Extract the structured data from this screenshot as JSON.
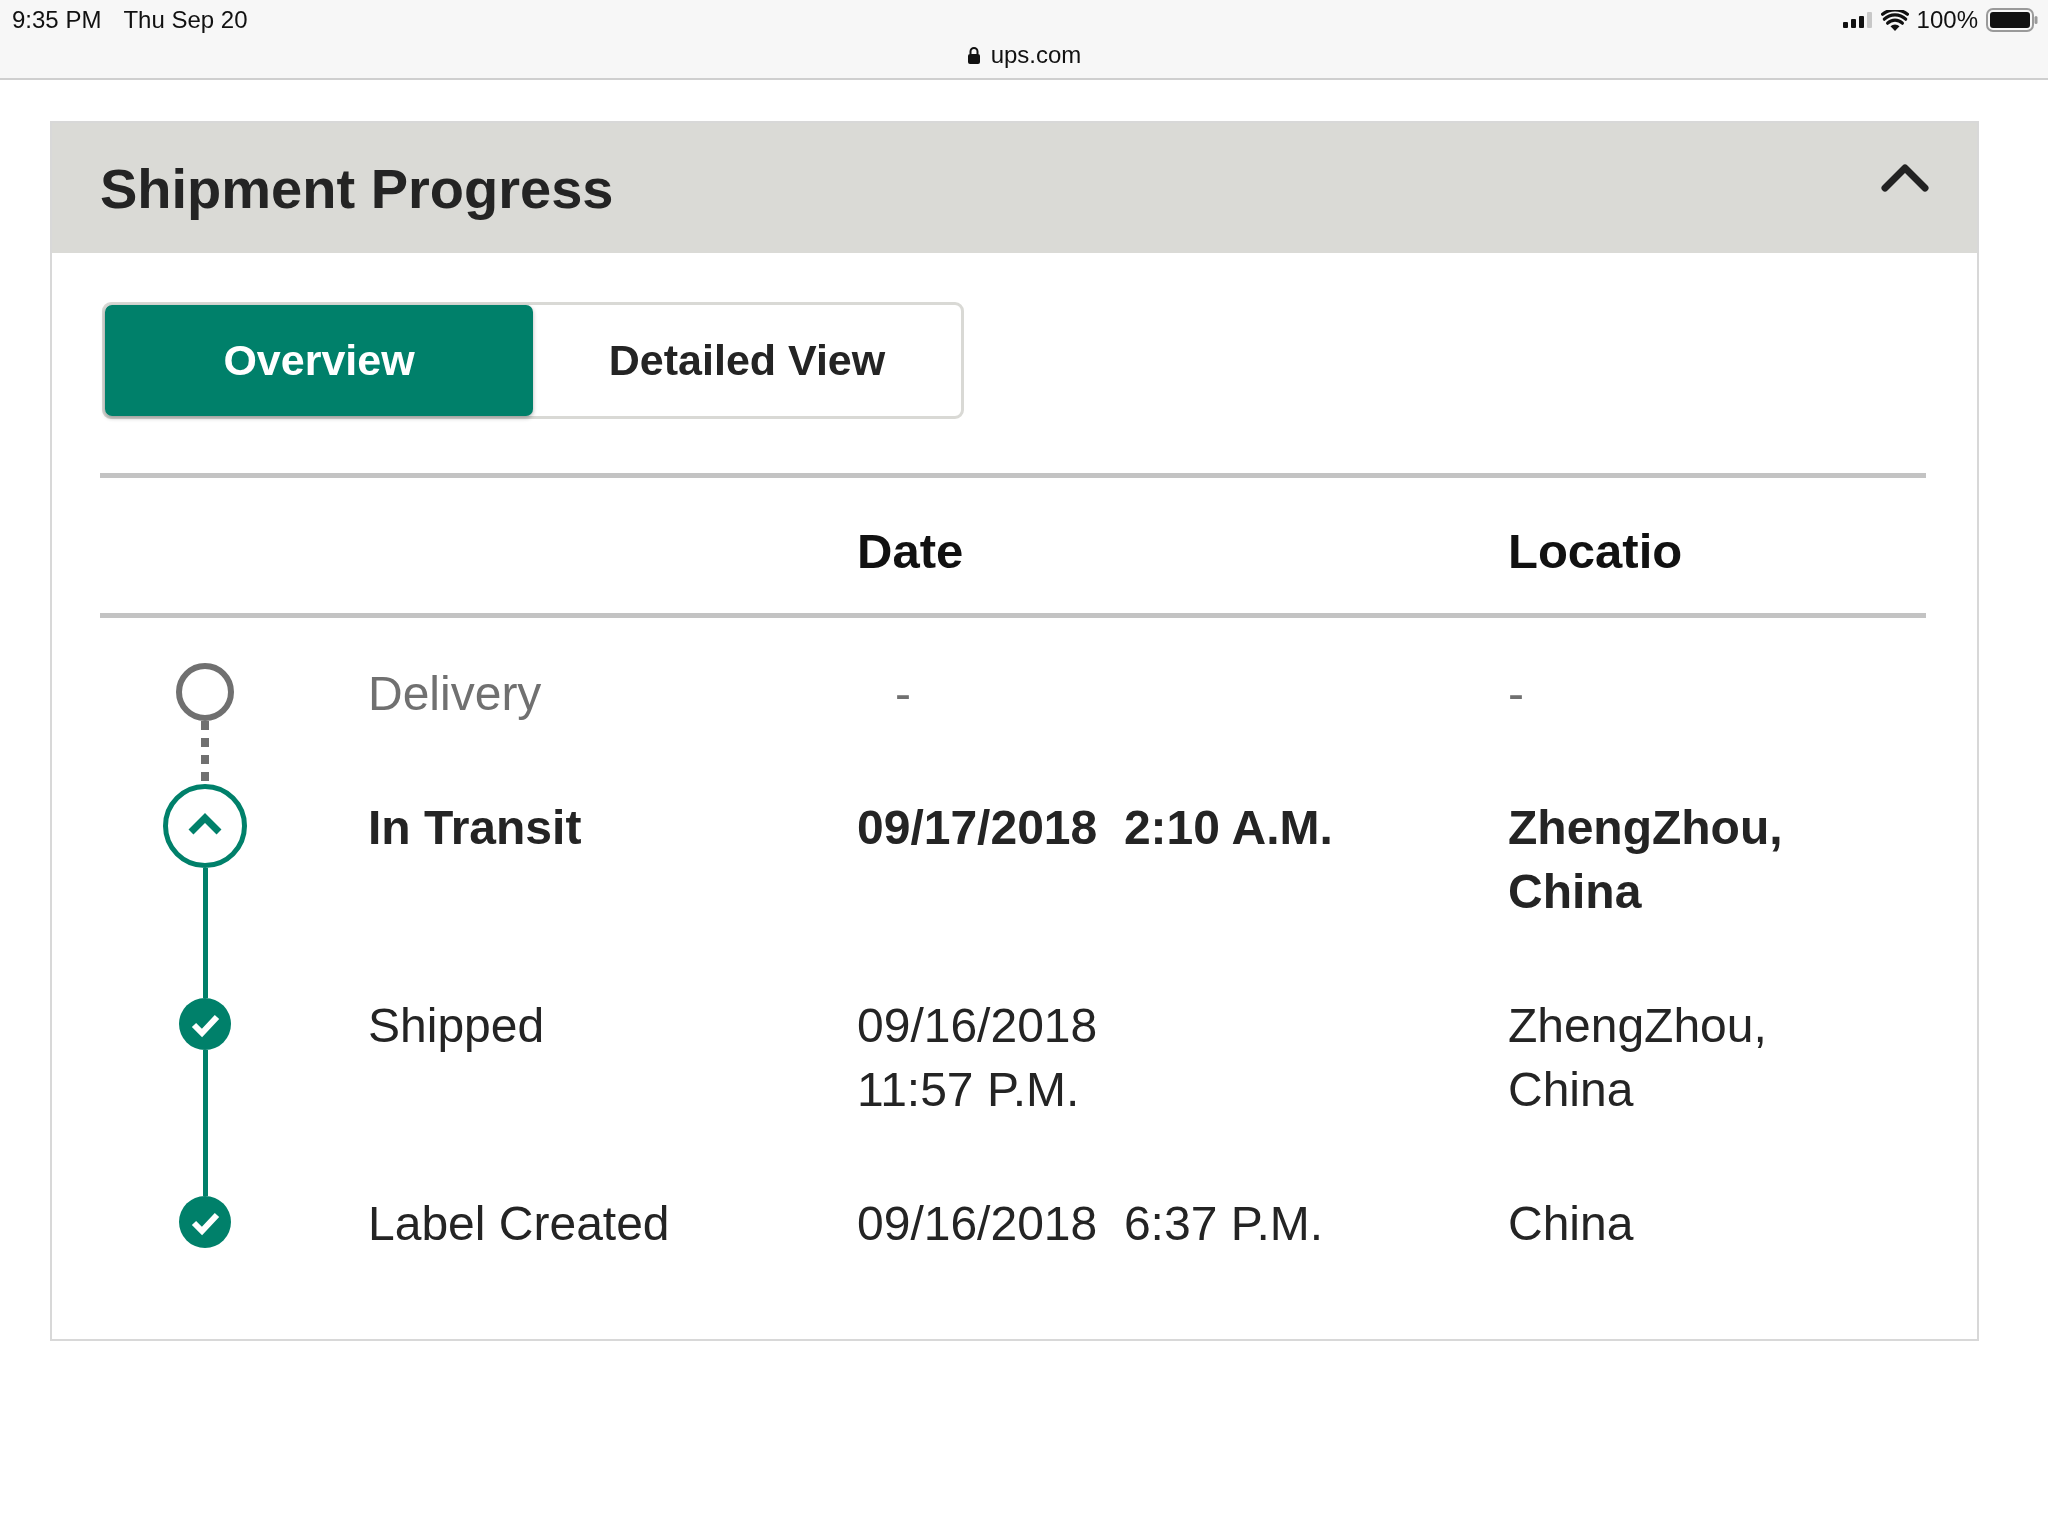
{
  "status_bar": {
    "time": "9:35 PM",
    "date": "Thu Sep 20",
    "url": "ups.com",
    "battery": "100%"
  },
  "panel": {
    "title": "Shipment Progress",
    "expanded": true,
    "tabs": [
      {
        "label": "Overview",
        "selected": true
      },
      {
        "label": "Detailed View",
        "selected": false
      }
    ],
    "table": {
      "columns": [
        "Date",
        "Locatio"
      ],
      "rows": [
        {
          "kind": "pending",
          "milestone": "Delivery",
          "date": "-",
          "location": "-"
        },
        {
          "kind": "current",
          "milestone": "In Transit",
          "date": "09/17/2018  2:10 A.M.",
          "location": "ZhengZhou, China"
        },
        {
          "kind": "done",
          "milestone": "Shipped",
          "date": "09/16/2018  11:57 P.M.",
          "location": "ZhengZhou, China"
        },
        {
          "kind": "done",
          "milestone": "Label Created",
          "date": "09/16/2018  6:37 P.M.",
          "location": "China"
        }
      ]
    }
  }
}
